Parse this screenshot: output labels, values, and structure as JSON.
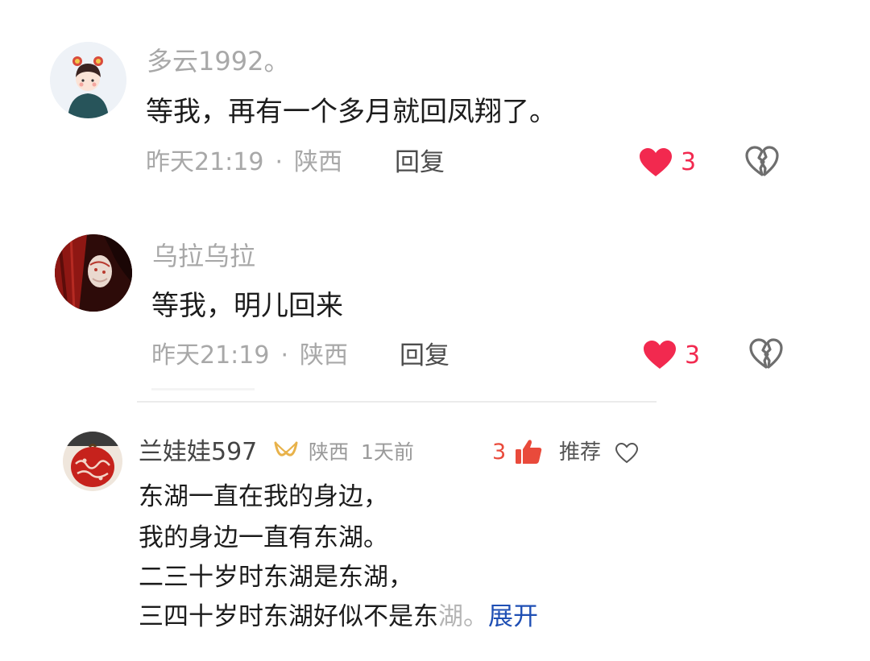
{
  "comments": [
    {
      "username": "多云1992。",
      "text": "等我，再有一个多月就回凤翔了。",
      "time": "昨天21:19",
      "separator": "·",
      "location": "陕西",
      "reply_label": "回复",
      "likes": "3"
    },
    {
      "username": "乌拉乌拉",
      "text": "等我，明儿回来",
      "time": "昨天21:19",
      "separator": "·",
      "location": "陕西",
      "reply_label": "回复",
      "likes": "3"
    }
  ],
  "third_comment": {
    "username": "兰娃娃597",
    "location": "陕西",
    "time": "1天前",
    "likes": "3",
    "recommend_label": "推荐",
    "lines": [
      "东湖一直在我的身边，",
      "我的身边一直有东湖。",
      "二三十岁时东湖是东湖，"
    ],
    "last_line_main": "三四十岁时东湖好似不是东",
    "last_line_faded": "湖。",
    "expand_label": "展开"
  },
  "colors": {
    "like_red": "#f2294f",
    "expand_blue": "#1f4fb4",
    "badge_gold": "#e8b24a"
  }
}
